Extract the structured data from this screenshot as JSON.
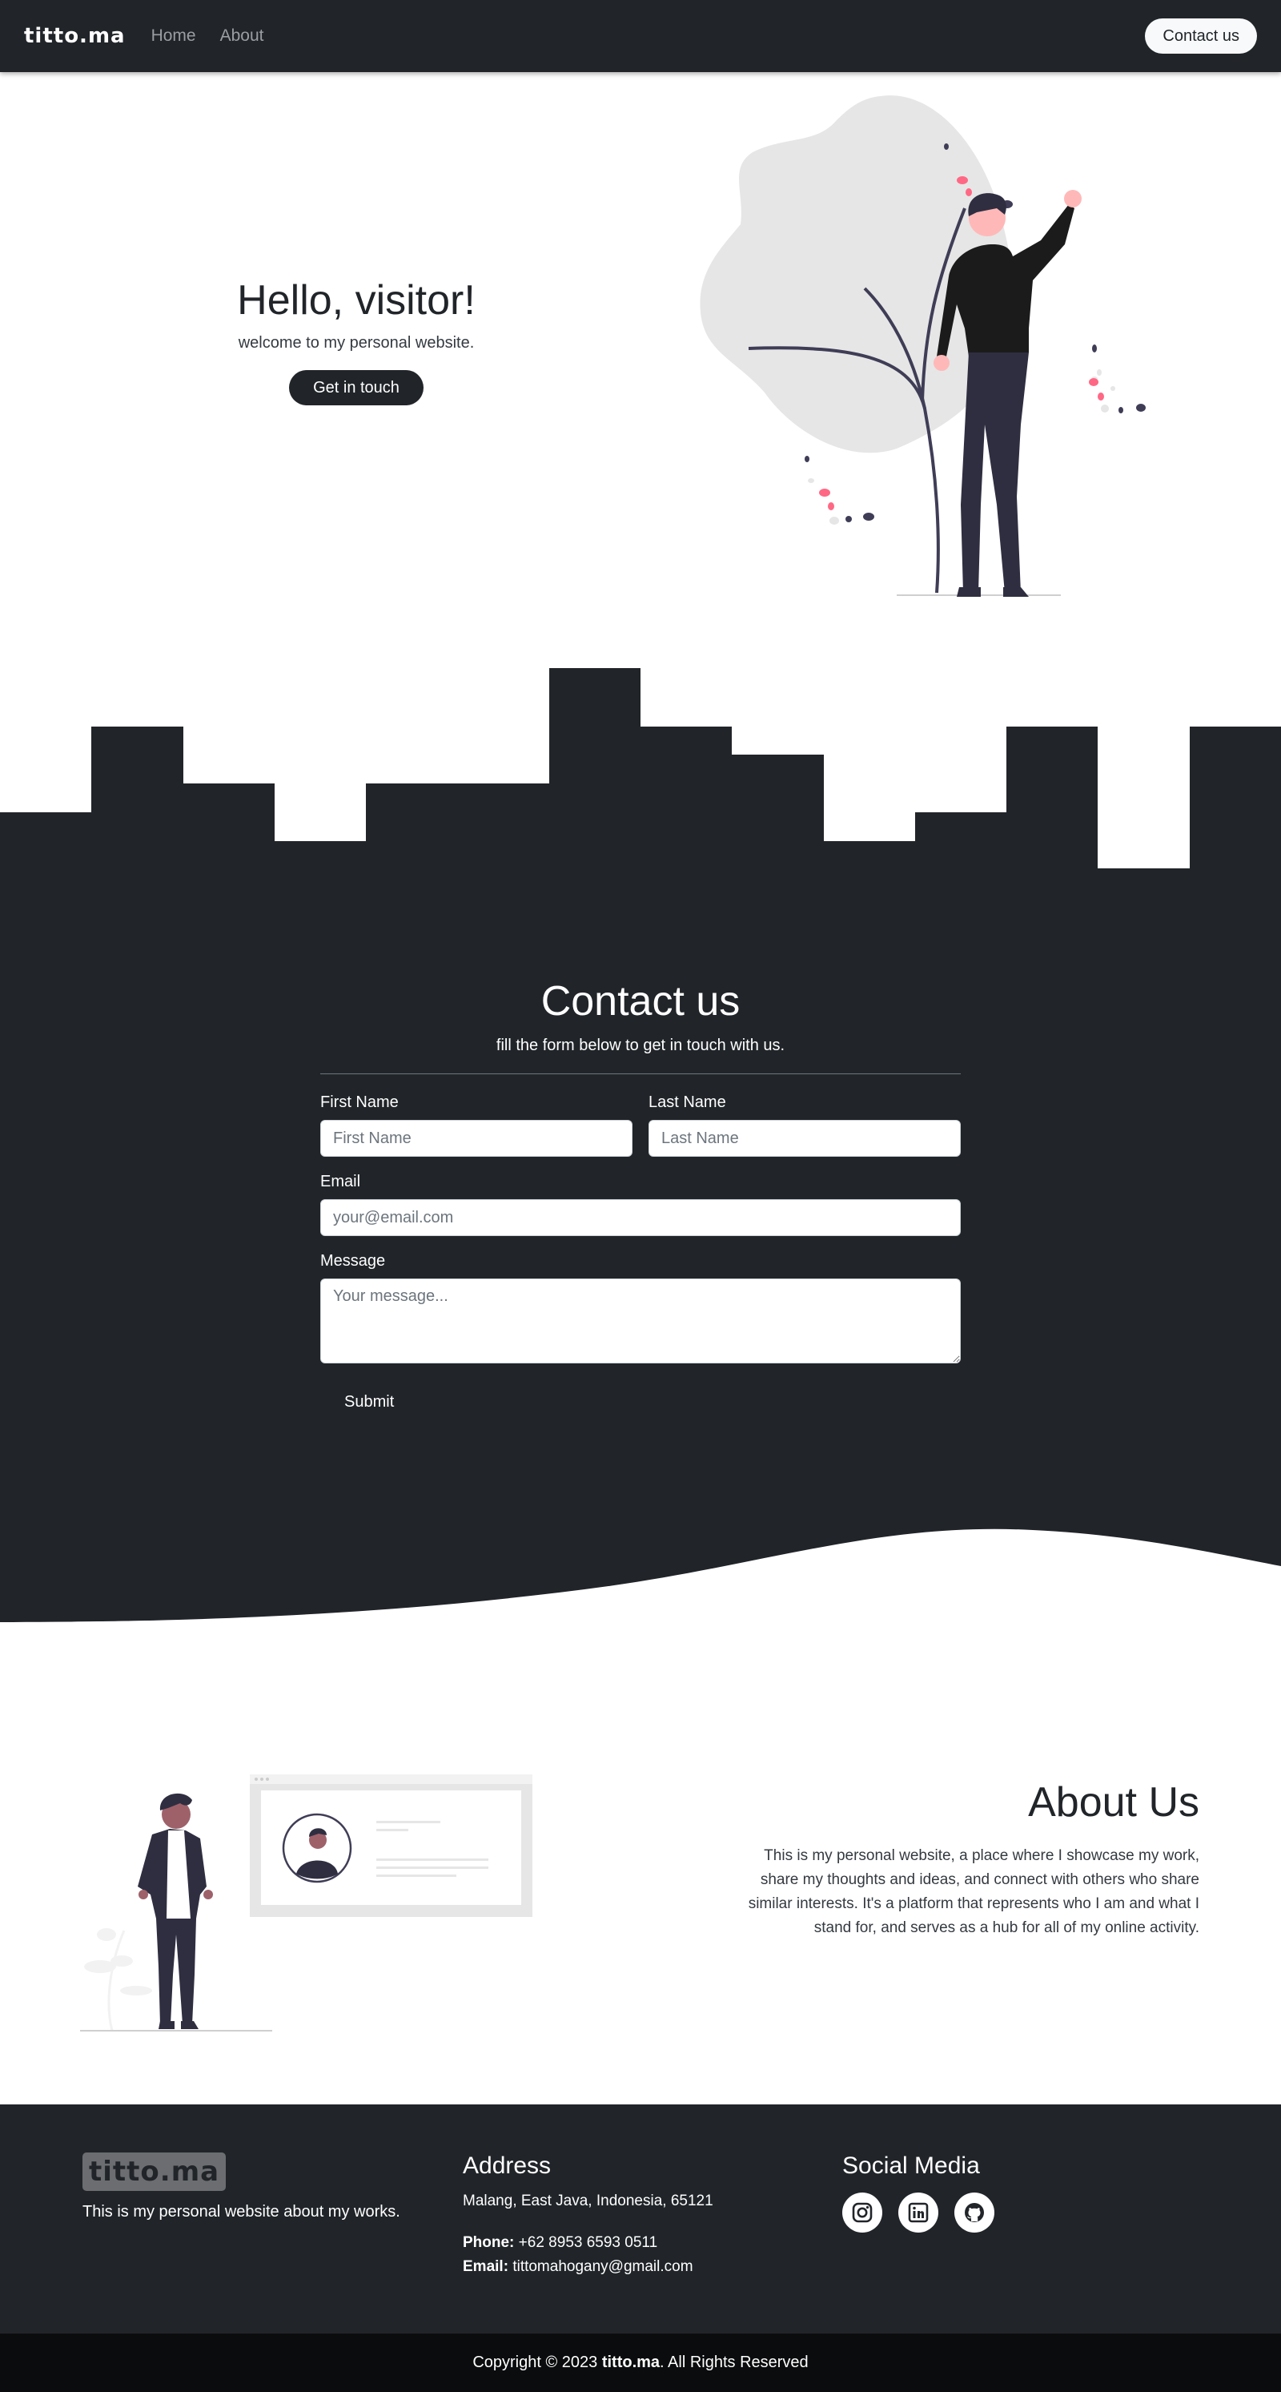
{
  "nav": {
    "brand": "titto.ma",
    "links": [
      "Home",
      "About"
    ],
    "contact_label": "Contact us"
  },
  "hero": {
    "title": "Hello, visitor!",
    "subtitle": "welcome to my personal website.",
    "button_label": "Get in touch"
  },
  "contact": {
    "title": "Contact us",
    "subtitle": "fill the form below to get in touch with us.",
    "first_name_label": "First Name",
    "first_name_placeholder": "First Name",
    "last_name_label": "Last Name",
    "last_name_placeholder": "Last Name",
    "email_label": "Email",
    "email_placeholder": "your@email.com",
    "message_label": "Message",
    "message_placeholder": "Your message...",
    "submit_label": "Submit"
  },
  "about": {
    "title": "About Us",
    "body": "This is my personal website, a place where I showcase my work, share my thoughts and ideas, and connect with others who share similar interests. It's a platform that represents who I am and what I stand for, and serves as a hub for all of my online activity."
  },
  "footer": {
    "logo": "titto.ma",
    "description": "This is my personal website about my works.",
    "address_title": "Address",
    "address": "Malang, East Java, Indonesia, 65121",
    "phone_label": "Phone:",
    "phone": "+62 8953 6593 0511",
    "email_label": "Email:",
    "email": "tittomahogany@gmail.com",
    "social_title": "Social Media",
    "social_icons": [
      "instagram-icon",
      "linkedin-icon",
      "github-icon"
    ]
  },
  "copyright": {
    "prefix": "Copyright © 2023",
    "brand": "titto.ma",
    "suffix": ". All Rights Reserved"
  },
  "colors": {
    "dark": "#212529",
    "accent_pink": "#ff6884",
    "light_gray": "#e6e6e6"
  }
}
